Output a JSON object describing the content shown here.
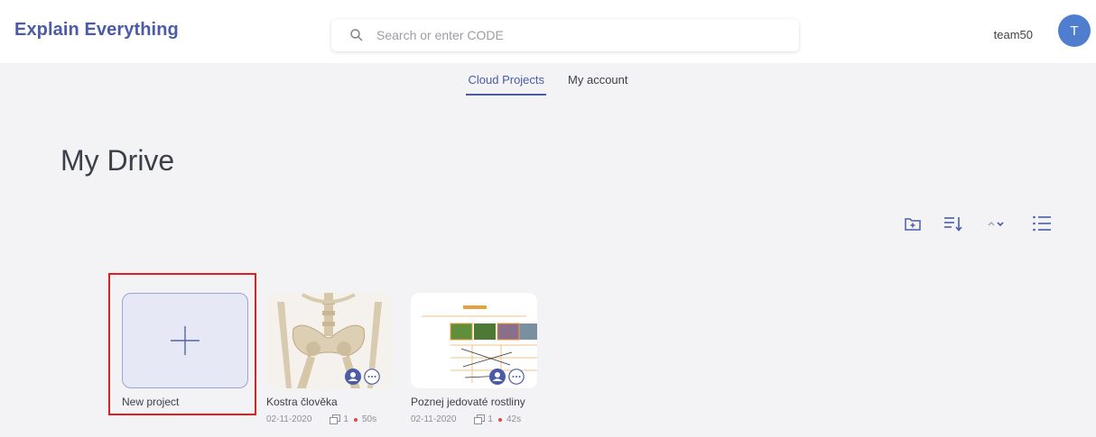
{
  "app": {
    "logo_text": "Explain Everything"
  },
  "header": {
    "search_placeholder": "Search or enter CODE",
    "username": "team50",
    "avatar_initial": "T"
  },
  "tabs": [
    {
      "label": "Cloud Projects",
      "active": true
    },
    {
      "label": "My account",
      "active": false
    }
  ],
  "page_title": "My Drive",
  "toolbar_icons": [
    "new-folder-icon",
    "sort-icon",
    "sort-order-icon",
    "list-view-icon"
  ],
  "new_project": {
    "label": "New project"
  },
  "projects": [
    {
      "name": "Kostra člověka",
      "date": "02-11-2020",
      "pages": "1",
      "duration": "50s"
    },
    {
      "name": "Poznej jedovaté rostliny",
      "date": "02-11-2020",
      "pages": "1",
      "duration": "42s"
    }
  ],
  "colors": {
    "brand": "#4a5ca8",
    "avatar": "#4f7ecf",
    "highlight": "#e21d1d",
    "recording_dot": "#e04545"
  }
}
